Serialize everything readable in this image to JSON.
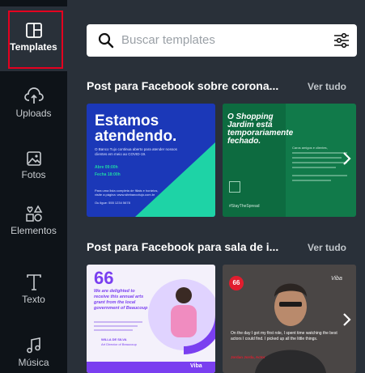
{
  "sidebar": {
    "items": [
      {
        "label": "Templates",
        "icon": "templates-icon",
        "active": true
      },
      {
        "label": "Uploads",
        "icon": "upload-cloud-icon"
      },
      {
        "label": "Fotos",
        "icon": "image-icon"
      },
      {
        "label": "Elementos",
        "icon": "shapes-icon"
      },
      {
        "label": "Texto",
        "icon": "text-icon"
      },
      {
        "label": "Música",
        "icon": "music-icon"
      }
    ]
  },
  "search": {
    "placeholder": "Buscar templates"
  },
  "sections": [
    {
      "title": "Post para Facebook sobre corona...",
      "see_all": "Ver tudo",
      "cards": [
        {
          "headline": "Estamos atendendo.",
          "body": "O Banco Tujo continua aberto para atender nossos clientes em meio ao COVID-19.",
          "hours_1": "Abre    09:00h",
          "hours_2": "Fecha   18:00h",
          "footer": "Para uma lista completa de filiais e horários, visite a página: www.sitebancotujo.com.br",
          "phone": "Ou ligue: 555 1234 5678"
        },
        {
          "headline": "O Shopping Jardim está temporariamente fechado.",
          "side": "Caros amigos e clientes,",
          "hashtag": "#StayTheSpread"
        }
      ]
    },
    {
      "title": "Post para Facebook para sala de i...",
      "see_all": "Ver tudo",
      "cards": [
        {
          "quote_mark": "66",
          "headline": "We are delighted to receive this annual arts grant from the local government of Beaucoup",
          "author": "WILLA DE SILVA",
          "role": "Art Director of Beaucoup",
          "brand": "Viba"
        },
        {
          "badge": "66",
          "brand": "Viba",
          "quote": "On the day I got my first role, I spent time watching the best actors I could find. I picked up all the little things.",
          "author": "Jordan Jorda, Actor"
        }
      ]
    }
  ],
  "colors": {
    "sidebar_bg": "#0e1318",
    "panel_bg": "#293039",
    "active_border": "#e5001f",
    "card1_bg": "#1b38b8",
    "card1_accent": "#1ed3a6",
    "card2_bg": "#117a4a",
    "card3_accent": "#7a3ff0"
  }
}
